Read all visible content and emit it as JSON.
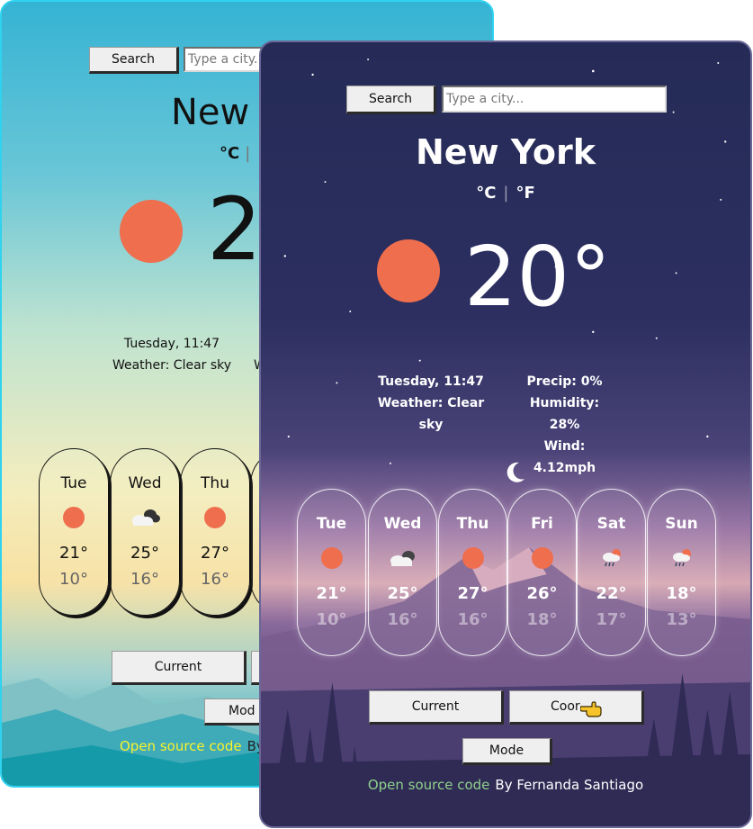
{
  "colors": {
    "back_border": "#2fd3ef",
    "front_border": "#6a6896",
    "sun": "#ee6e4e",
    "link_back": "#f8f32b",
    "link_front": "#8fd18a"
  },
  "back_card": {
    "search_label": "Search",
    "search_placeholder": "Type a city...",
    "city": "New Y",
    "unit_c": "°C",
    "unit_sep": "|",
    "temp": "2(",
    "date": "Tuesday, 11:47",
    "weather": "Weather: Clear sky",
    "extra": "W",
    "forecast": [
      {
        "day": "Tue",
        "icon": "sun-icon",
        "high": "21°",
        "low": "10°"
      },
      {
        "day": "Wed",
        "icon": "cloud-dark-icon",
        "high": "25°",
        "low": "16°"
      },
      {
        "day": "Thu",
        "icon": "sun-icon",
        "high": "27°",
        "low": "16°"
      }
    ],
    "current_label": "Current",
    "mode_label": "Mod",
    "footer_link": "Open source code",
    "footer_by": "By"
  },
  "front_card": {
    "search_label": "Search",
    "search_placeholder": "Type a city...",
    "city": "New York",
    "unit_c": "°C",
    "unit_sep": "|",
    "unit_f": "°F",
    "temp": "20°",
    "date": "Tuesday, 11:47",
    "weather": "Weather: Clear sky",
    "precip": "Precip: 0%",
    "humidity": "Humidity: 28%",
    "wind": "Wind: 4.12mph",
    "forecast": [
      {
        "day": "Tue",
        "icon": "sun-icon",
        "high": "21°",
        "low": "10°"
      },
      {
        "day": "Wed",
        "icon": "cloud-icon",
        "high": "25°",
        "low": "16°"
      },
      {
        "day": "Thu",
        "icon": "sun-icon",
        "high": "27°",
        "low": "16°"
      },
      {
        "day": "Fri",
        "icon": "sun-icon",
        "high": "26°",
        "low": "18°"
      },
      {
        "day": "Sat",
        "icon": "rain-sun-icon",
        "high": "22°",
        "low": "17°"
      },
      {
        "day": "Sun",
        "icon": "rain-sun-icon",
        "high": "18°",
        "low": "13°"
      }
    ],
    "current_label": "Current",
    "coords_label": "Coor",
    "mode_label": "Mode",
    "footer_link": "Open source code",
    "footer_by": "By Fernanda Santiago"
  }
}
